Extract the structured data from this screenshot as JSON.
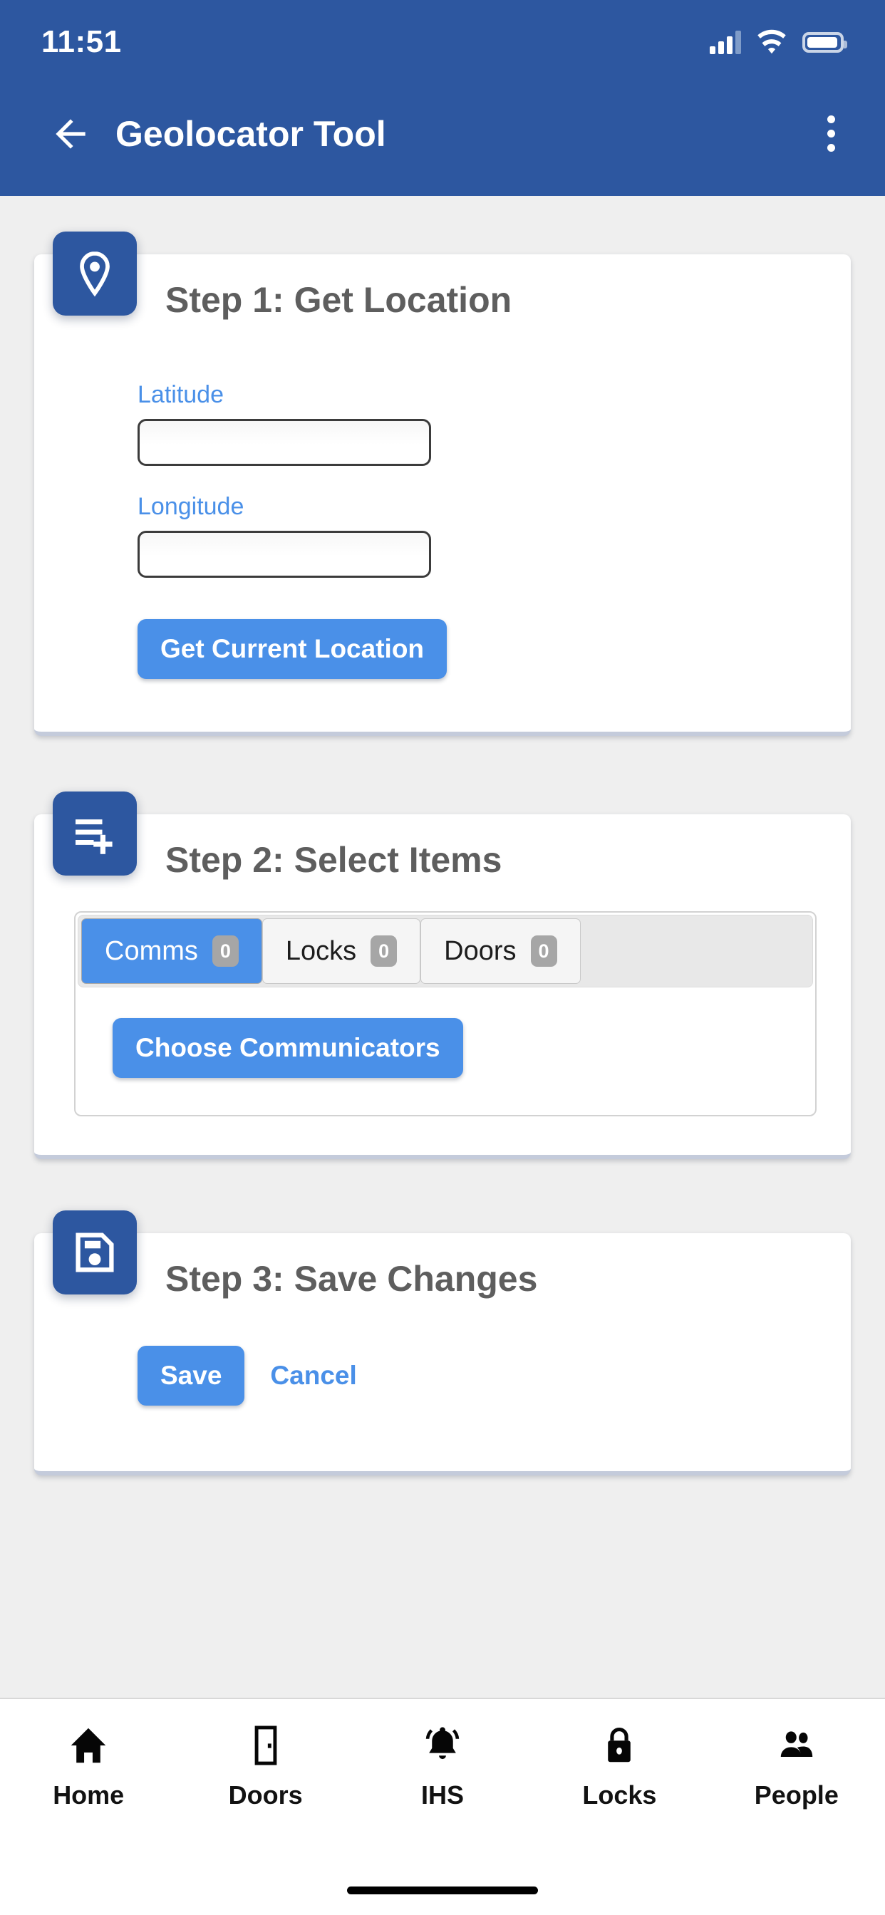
{
  "statusbar": {
    "time": "11:51",
    "signal_icon": "cellular-signal-icon",
    "wifi_icon": "wifi-icon",
    "battery_icon": "battery-icon"
  },
  "appbar": {
    "back_icon": "back-arrow-icon",
    "title": "Geolocator Tool",
    "overflow_icon": "more-vertical-icon",
    "background_color": "#2d57a0"
  },
  "steps": [
    {
      "icon": "location-pin-icon",
      "title": "Step 1: Get Location",
      "fields": [
        {
          "label": "Latitude",
          "value": "",
          "placeholder": ""
        },
        {
          "label": "Longitude",
          "value": "",
          "placeholder": ""
        }
      ],
      "action": {
        "label": "Get Current Location",
        "style": "filled"
      }
    },
    {
      "icon": "playlist-add-icon",
      "title": "Step 2: Select Items",
      "tabs": [
        {
          "label": "Comms",
          "count": "0",
          "active": true
        },
        {
          "label": "Locks",
          "count": "0",
          "active": false
        },
        {
          "label": "Doors",
          "count": "0",
          "active": false
        }
      ],
      "action": {
        "label": "Choose Communicators",
        "style": "filled"
      }
    },
    {
      "icon": "save-disk-icon",
      "title": "Step 3: Save Changes",
      "actions": [
        {
          "label": "Save",
          "style": "filled"
        },
        {
          "label": "Cancel",
          "style": "link"
        }
      ]
    }
  ],
  "bottom_nav": [
    {
      "label": "Home",
      "icon": "home-icon"
    },
    {
      "label": "Doors",
      "icon": "door-icon"
    },
    {
      "label": "IHS",
      "icon": "bell-ring-icon"
    },
    {
      "label": "Locks",
      "icon": "lock-icon"
    },
    {
      "label": "People",
      "icon": "people-icon"
    }
  ],
  "colors": {
    "header_blue": "#2d57a0",
    "accent_blue": "#4a90e8",
    "badge_gray": "#a6a6a6",
    "page_background": "#efefef",
    "title_gray": "#5e5e5e"
  }
}
